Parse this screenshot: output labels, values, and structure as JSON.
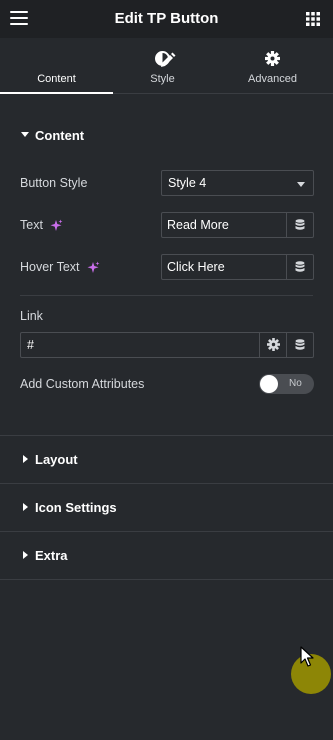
{
  "header": {
    "title": "Edit TP Button"
  },
  "tabs": [
    {
      "label": "Content",
      "icon": "pencil-icon",
      "active": true
    },
    {
      "label": "Style",
      "icon": "half-circle-icon",
      "active": false
    },
    {
      "label": "Advanced",
      "icon": "gear-icon",
      "active": false
    }
  ],
  "content_section": {
    "title": "Content",
    "button_style": {
      "label": "Button Style",
      "value": "Style 4"
    },
    "text": {
      "label": "Text",
      "value": "Read More"
    },
    "hover_text": {
      "label": "Hover Text",
      "value": "Click Here"
    },
    "link": {
      "label": "Link",
      "value": "#"
    },
    "custom_attributes": {
      "label": "Add Custom Attributes",
      "toggle_text": "No",
      "on": false
    }
  },
  "collapsed_sections": [
    {
      "title": "Layout"
    },
    {
      "title": "Icon Settings"
    },
    {
      "title": "Extra"
    }
  ],
  "colors": {
    "accent_ai": "#c86eea",
    "panel_bg": "#26292d",
    "header_bg": "#1f2124",
    "cursor_highlight": "#a09600"
  }
}
